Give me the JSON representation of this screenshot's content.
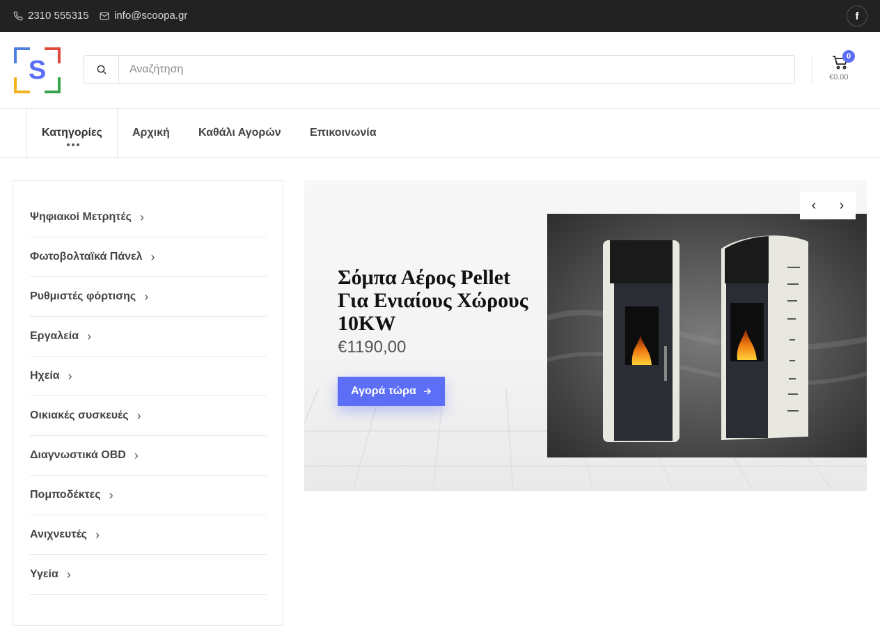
{
  "topbar": {
    "phone": "2310 555315",
    "email": "info@scoopa.gr",
    "facebook_icon": "f"
  },
  "header": {
    "logo_letter": "S",
    "search_placeholder": "Αναζήτηση",
    "cart_count": "0",
    "cart_total": "€0.00"
  },
  "nav": {
    "categories_label": "Κατηγορίες",
    "links": [
      "Αρχική",
      "Καθάλι Αγορών",
      "Επικοινωνία"
    ]
  },
  "sidebar": {
    "items": [
      "Ψηφιακοί Μετρητές",
      "Φωτοβολταϊκά Πάνελ",
      "Ρυθμιστές φόρτισης",
      "Εργαλεία",
      "Ηχεία",
      "Οικιακές συσκευές",
      "Διαγνωστικά OBD",
      "Πομποδέκτες",
      "Ανιχνευτές",
      "Υγεία"
    ]
  },
  "hero": {
    "title": "Σόμπα Αέρος Pellet Για Ενιαίους Χώρους 10KW",
    "price": "€1190,00",
    "cta_label": "Αγορά τώρα",
    "prev_label": "‹",
    "next_label": "›"
  },
  "colors": {
    "accent": "#5b6ef5",
    "topbar": "#222222"
  }
}
